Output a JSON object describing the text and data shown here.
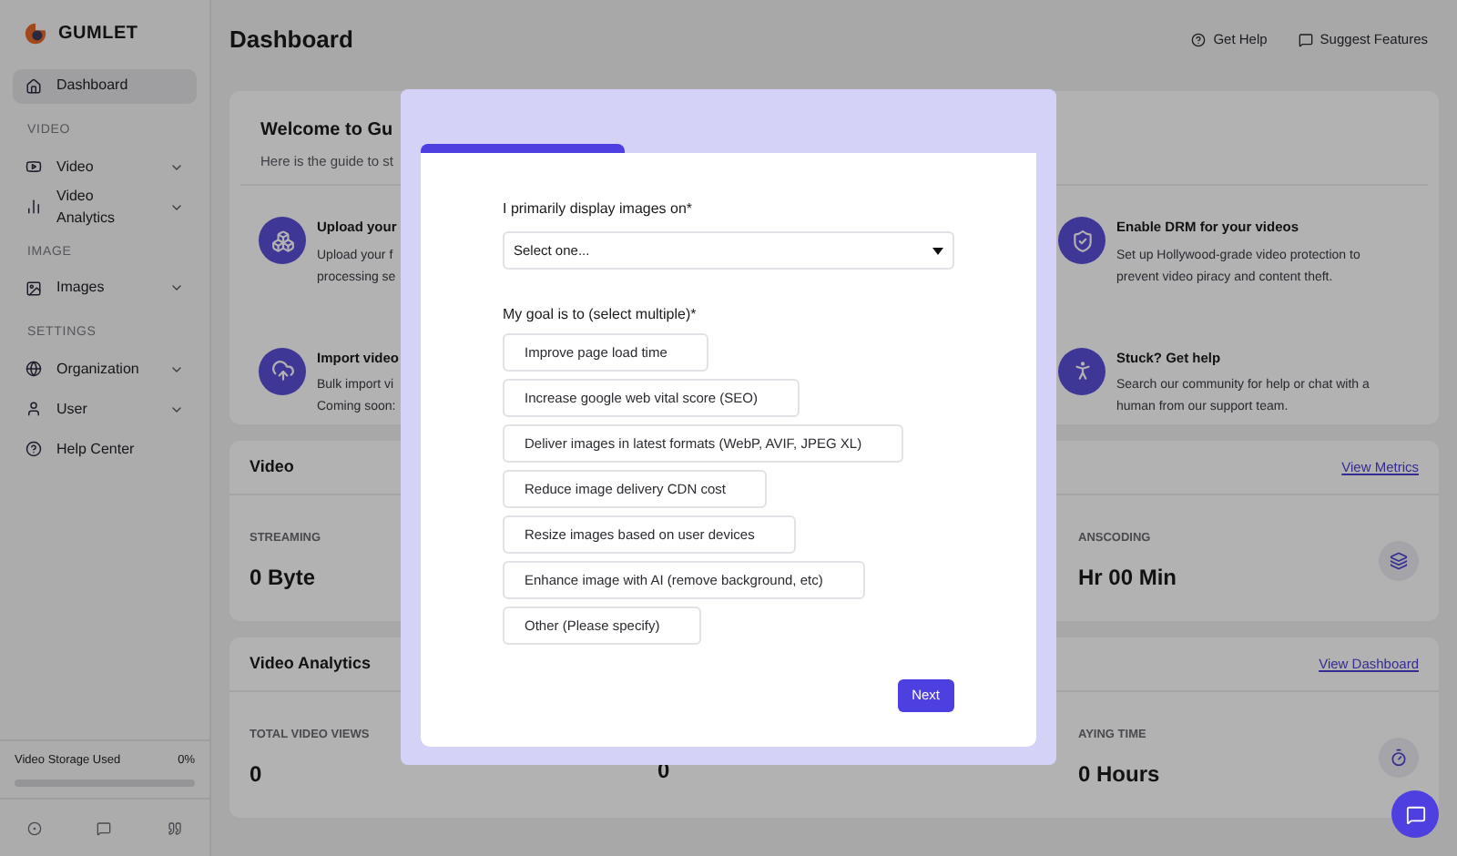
{
  "sidebar": {
    "logo": "GUMLET",
    "sections": [
      {
        "items": [
          {
            "label": "Dashboard",
            "selected": true,
            "expandable": false
          }
        ]
      },
      {
        "heading": "VIDEO",
        "items": [
          {
            "label": "Video",
            "selected": false,
            "expandable": true
          },
          {
            "label": "Video Analytics",
            "selected": false,
            "expandable": true
          }
        ]
      },
      {
        "heading": "IMAGE",
        "items": [
          {
            "label": "Images",
            "selected": false,
            "expandable": true
          }
        ]
      },
      {
        "heading": "SETTINGS",
        "items": [
          {
            "label": "Organization",
            "selected": false,
            "expandable": true
          },
          {
            "label": "User",
            "selected": false,
            "expandable": true
          },
          {
            "label": "Help Center",
            "selected": false,
            "expandable": false
          }
        ]
      }
    ],
    "storage": {
      "label": "Video Storage Used",
      "reading": "0%",
      "level": 0
    }
  },
  "header": {
    "title": "Dashboard",
    "actions": [
      "Get Help",
      "Suggest Features"
    ]
  },
  "welcome": {
    "title": "Welcome to Gu",
    "subtitle": "Here is the guide to st",
    "left": [
      {
        "title": "Upload your",
        "text": [
          "Upload your f",
          "processing se"
        ]
      },
      {
        "title": "Import video",
        "text": [
          "Bulk import vi",
          "Coming soon:"
        ]
      }
    ],
    "right": [
      {
        "title": "Enable DRM for your videos",
        "text": [
          "Set up Hollywood-grade video protection to",
          "prevent video piracy and content theft."
        ]
      },
      {
        "title": "Stuck? Get help",
        "text": [
          "Search our community for help or chat with a",
          "human from our support team."
        ]
      }
    ]
  },
  "panels": [
    {
      "title": "Video",
      "link": "View Metrics",
      "stats": [
        {
          "label": "STREAMING",
          "value": "0 Byte"
        },
        {
          "label": "ANSCODING",
          "value": "Hr 00 Min"
        }
      ]
    },
    {
      "title": "Video Analytics",
      "link": "View Dashboard",
      "stats": [
        {
          "label": "TOTAL VIDEO VIEWS",
          "value": "0"
        },
        {
          "value": "0"
        },
        {
          "label": "AYING TIME",
          "value": "0 Hours"
        }
      ]
    }
  ],
  "modal": {
    "level": 0.33,
    "select_label": "I primarily display images on*",
    "select_placeholder": "Select one...",
    "goals_label": "My goal is to (select multiple)*",
    "goals": [
      {
        "label": "Improve page load time",
        "selected": false
      },
      {
        "label": "Increase google web vital score (SEO)",
        "selected": false
      },
      {
        "label": "Deliver images in latest formats (WebP, AVIF, JPEG XL)",
        "selected": false
      },
      {
        "label": "Reduce image delivery CDN cost",
        "selected": false
      },
      {
        "label": "Resize images based on user devices",
        "selected": false
      },
      {
        "label": "Enhance image with AI (remove background, etc)",
        "selected": false
      },
      {
        "label": "Other (Please specify)",
        "selected": false
      }
    ],
    "button": "Next"
  }
}
